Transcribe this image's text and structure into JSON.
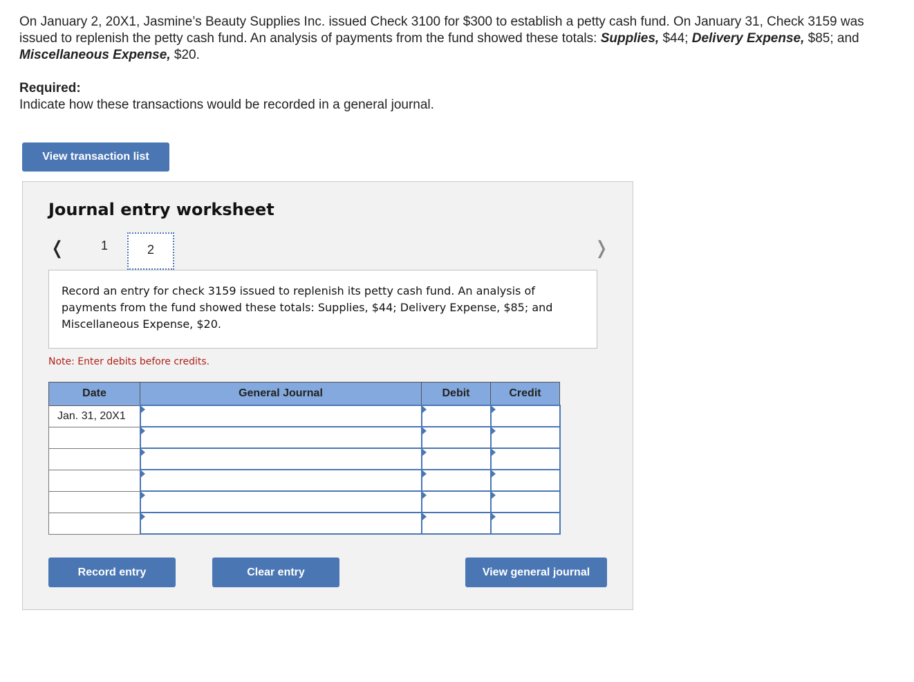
{
  "problem": {
    "text_1": "On January 2, 20X1, Jasmine’s Beauty Supplies Inc. issued Check 3100 for $300 to establish a petty cash fund. On January 31, Check 3159 was issued to replenish the petty cash fund. An analysis of payments from the fund showed these totals: ",
    "bold_1": "Supplies,",
    "text_2": " $44; ",
    "bold_2": "Delivery Expense,",
    "text_3": " $85; and ",
    "bold_3": "Miscellaneous Expense,",
    "text_4": " $20."
  },
  "required": {
    "title": "Required:",
    "text": "Indicate how these transactions would be recorded in a general journal."
  },
  "buttons": {
    "view_transaction_list": "View transaction list",
    "record_entry": "Record entry",
    "clear_entry": "Clear entry",
    "view_general_journal": "View general journal"
  },
  "worksheet": {
    "title": "Journal entry worksheet",
    "nav_prev": "<",
    "nav_next": ">",
    "tabs": [
      "1",
      "2"
    ],
    "active_tab": "2",
    "instruction": "Record an entry for check 3159 issued to replenish its petty cash fund. An analysis of payments from the fund showed these totals: Supplies, $44; Delivery Expense, $85; and Miscellaneous Expense, $20.",
    "note": "Note: Enter debits before credits."
  },
  "journal": {
    "headers": [
      "Date",
      "General Journal",
      "Debit",
      "Credit"
    ],
    "rows": [
      {
        "date": "Jan. 31, 20X1",
        "account": "",
        "debit": "",
        "credit": ""
      },
      {
        "date": "",
        "account": "",
        "debit": "",
        "credit": ""
      },
      {
        "date": "",
        "account": "",
        "debit": "",
        "credit": ""
      },
      {
        "date": "",
        "account": "",
        "debit": "",
        "credit": ""
      },
      {
        "date": "",
        "account": "",
        "debit": "",
        "credit": ""
      },
      {
        "date": "",
        "account": "",
        "debit": "",
        "credit": ""
      }
    ]
  }
}
